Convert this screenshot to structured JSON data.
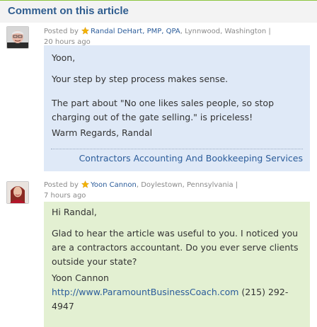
{
  "header": {
    "title": "Comment on this article"
  },
  "comments": [
    {
      "posted_by_prefix": "Posted by",
      "author": "Randal DeHart, PMP, QPA",
      "location": ", Lynnwood, Washington",
      "separator": "|",
      "time": "20 hours ago",
      "lines": [
        "Yoon,",
        "Your step by step process makes sense.",
        "The part about \"No one likes sales people, so stop charging out of the gate selling.\" is priceless!",
        "Warm Regards, Randal"
      ],
      "signature_link": "Contractors Accounting And Bookkeeping Services"
    },
    {
      "posted_by_prefix": "Posted by",
      "author": "Yoon Cannon",
      "location": ", Doylestown, Pennsylvania",
      "separator": "|",
      "time": "7 hours ago",
      "lines": [
        "Hi Randal,",
        "Glad to hear the article was useful to you. I noticed you are a contractors accountant. Do you ever serve clients outside your state?",
        "Yoon Cannon"
      ],
      "website": "http://www.ParamountBusinessCoach.com",
      "phone": " (215) 292-4947"
    }
  ],
  "colors": {
    "header_title": "#2f5d8f",
    "link": "#2b5c9a",
    "bubble1": "#dfe9f7",
    "bubble2": "#e3f0d2",
    "header_rule": "#8cc63f"
  },
  "icons": {
    "featured": "star-icon"
  }
}
